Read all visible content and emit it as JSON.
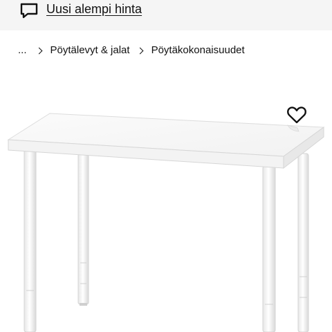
{
  "promo": {
    "icon": "speech-bubble-icon",
    "link_label": "Uusi alempi hinta"
  },
  "breadcrumb": {
    "ellipsis": "...",
    "items": [
      {
        "label": "Pöytälevyt & jalat"
      },
      {
        "label": "Pöytäkokonaisuudet"
      }
    ]
  },
  "product": {
    "image_subject": "white-table",
    "favourite_icon": "heart-icon"
  },
  "colors": {
    "banner_bg": "#f5f5f5",
    "text": "#111111",
    "table_white": "#ffffff"
  }
}
